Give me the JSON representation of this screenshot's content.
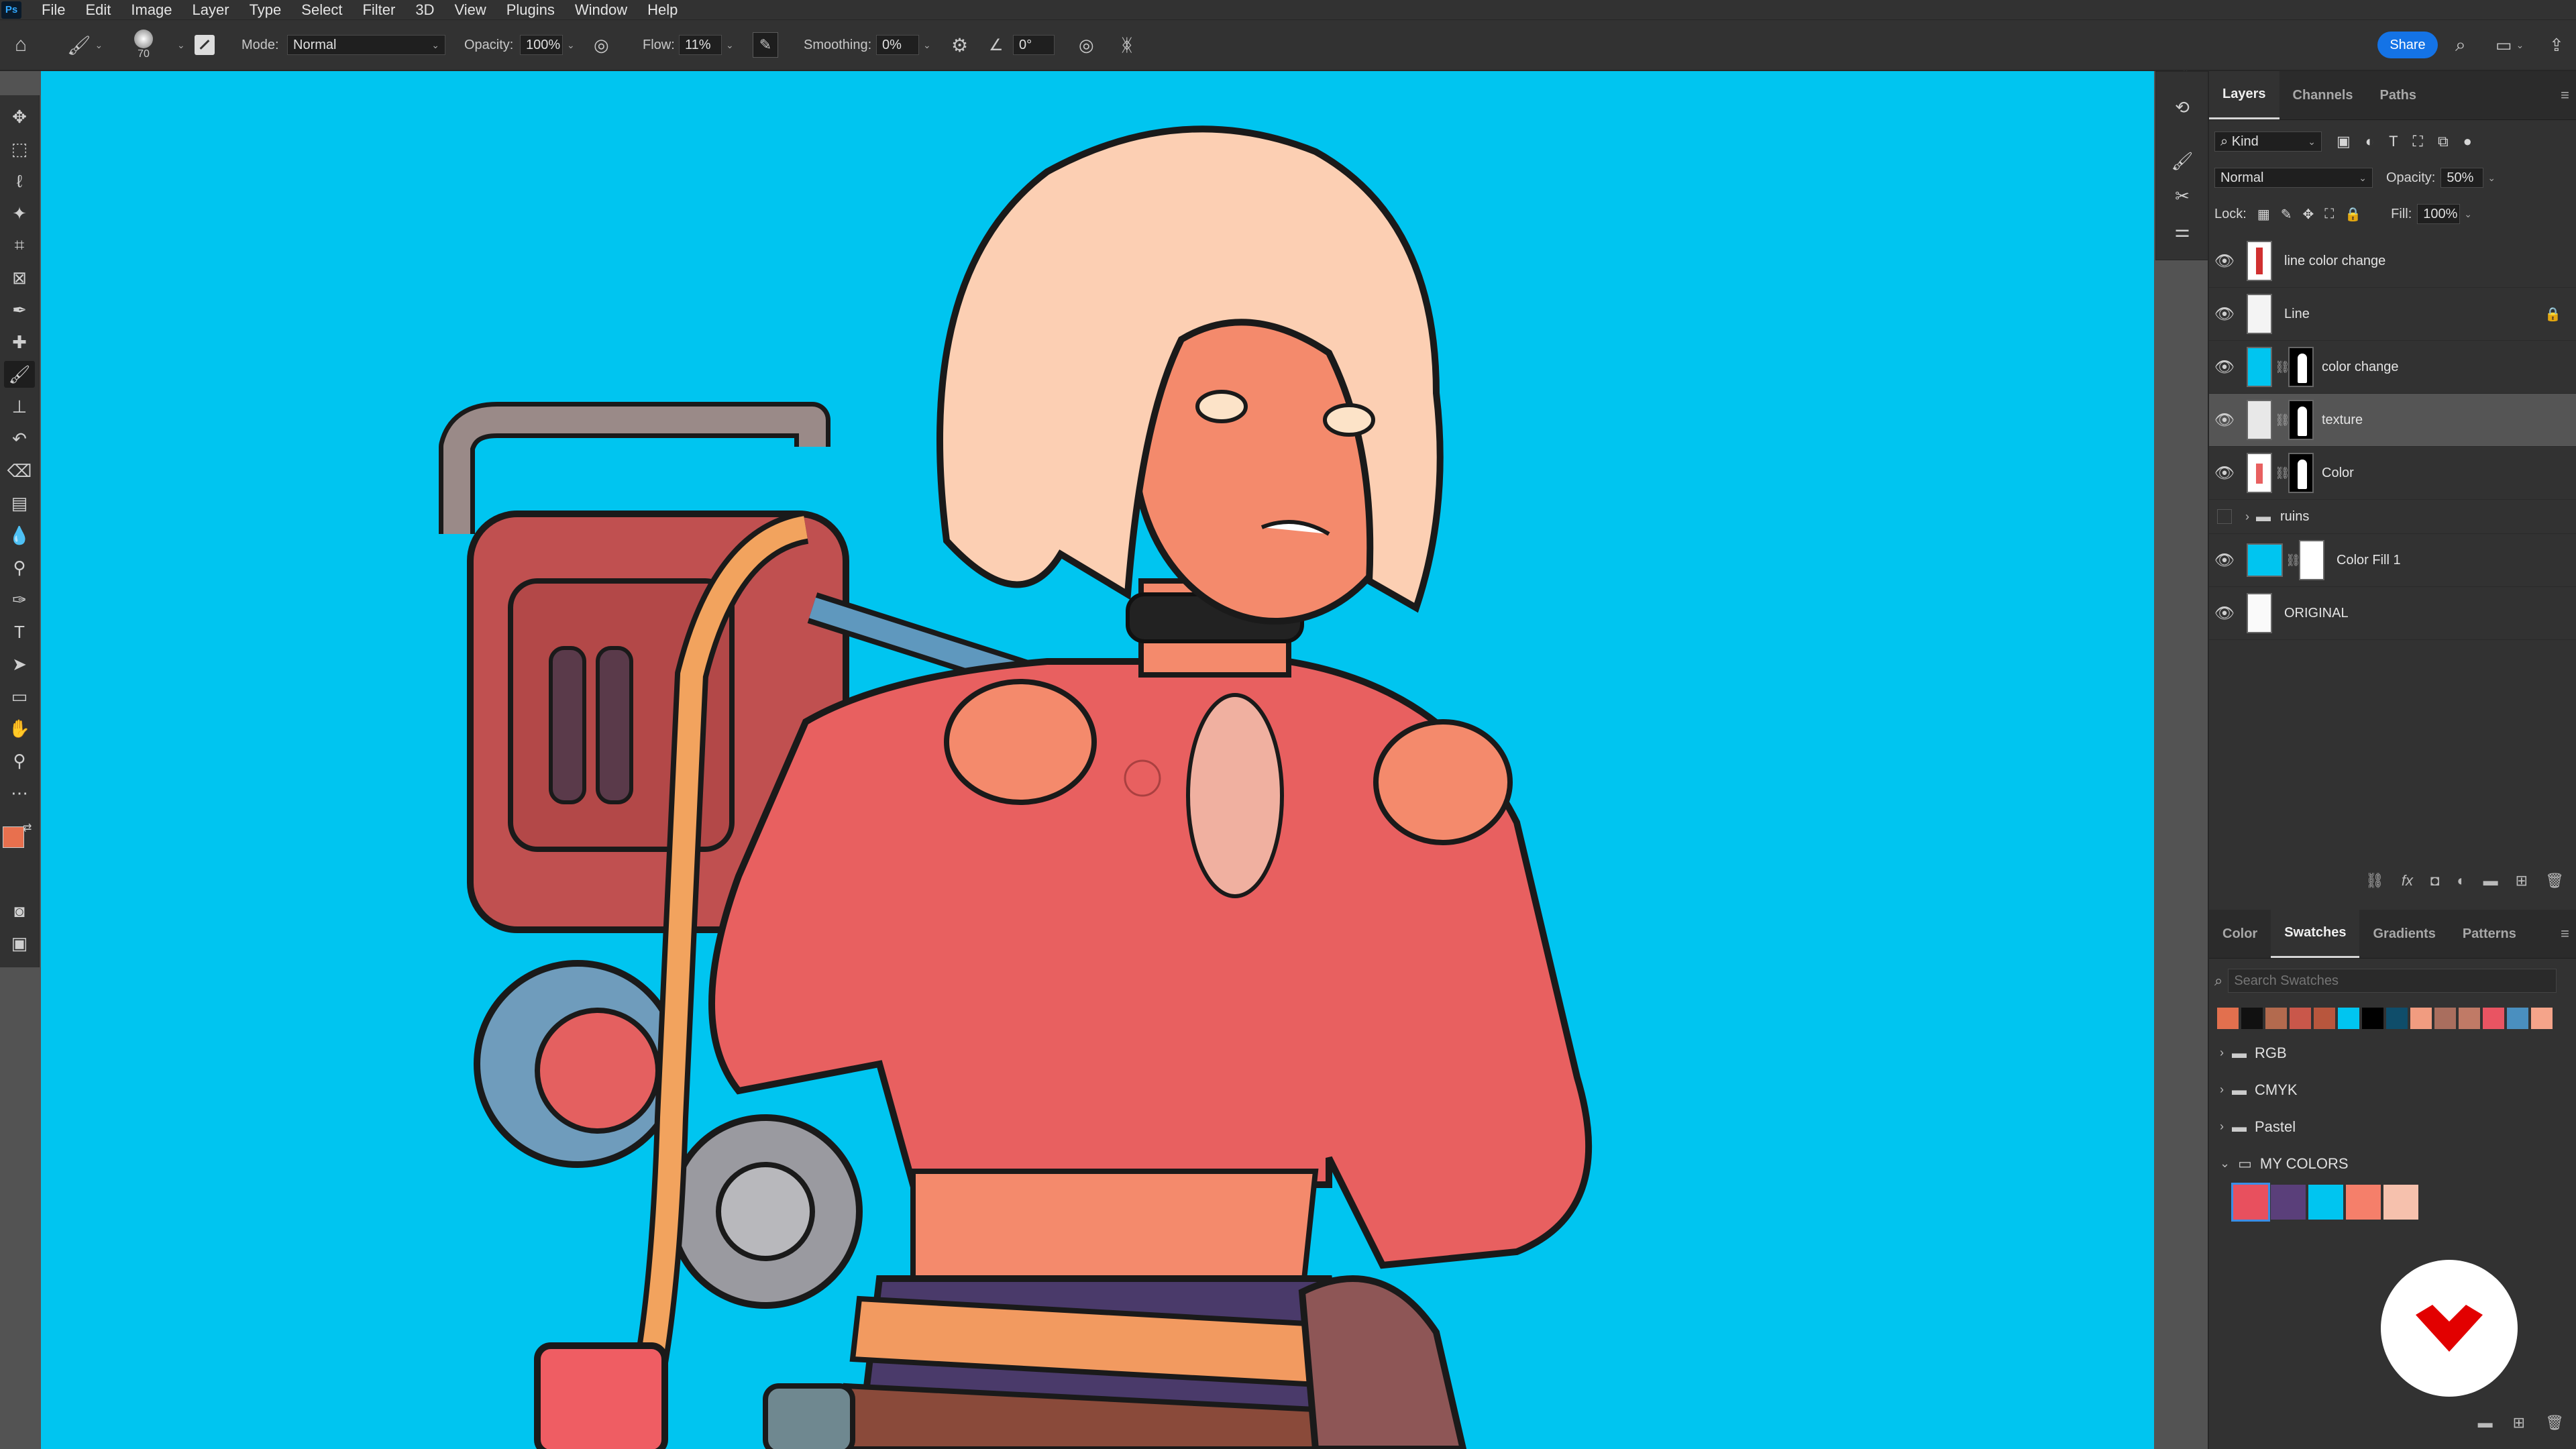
{
  "menu": [
    "File",
    "Edit",
    "Image",
    "Layer",
    "Type",
    "Select",
    "Filter",
    "3D",
    "View",
    "Plugins",
    "Window",
    "Help"
  ],
  "options": {
    "brush_size": "70",
    "mode_label": "Mode:",
    "mode_value": "Normal",
    "opacity_label": "Opacity:",
    "opacity_value": "100%",
    "flow_label": "Flow:",
    "flow_value": "11%",
    "smoothing_label": "Smoothing:",
    "smoothing_value": "0%",
    "angle_value": "0°",
    "share_label": "Share"
  },
  "layers_panel": {
    "tabs": [
      "Layers",
      "Channels",
      "Paths"
    ],
    "filter_kind": "Kind",
    "blend_mode": "Normal",
    "opacity_label": "Opacity:",
    "opacity_value": "50%",
    "lock_label": "Lock:",
    "fill_label": "Fill:",
    "fill_value": "100%",
    "layers": [
      {
        "name": "line color change"
      },
      {
        "name": "Line"
      },
      {
        "name": "color change"
      },
      {
        "name": "texture"
      },
      {
        "name": "Color"
      },
      {
        "name": "ruins"
      },
      {
        "name": "Color Fill 1"
      },
      {
        "name": "ORIGINAL"
      }
    ]
  },
  "swatches_panel": {
    "tabs": [
      "Color",
      "Swatches",
      "Gradients",
      "Patterns"
    ],
    "search_placeholder": "Search Swatches",
    "recent": [
      "#e2704e",
      "#111111",
      "#b36a4e",
      "#c9574a",
      "#b8563d",
      "#00c5f0",
      "#000000",
      "#0f4d6a",
      "#f19c80",
      "#a96e5e",
      "#c07a66",
      "#e95462",
      "#4a8fbf",
      "#f5a48a"
    ],
    "groups": [
      "RGB",
      "CMYK",
      "Pastel",
      "MY COLORS"
    ],
    "my_colors": [
      "#e8505e",
      "#5a3f7a",
      "#00c5f0",
      "#f57f6a",
      "#f6c1ad"
    ]
  },
  "colors": {
    "canvas_bg": "#00c5f0",
    "foreground": "#e8704e",
    "background": "#ffffff",
    "accent": "#1473e6"
  }
}
